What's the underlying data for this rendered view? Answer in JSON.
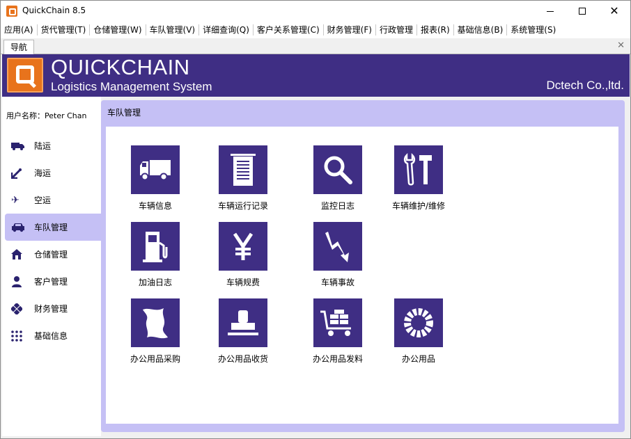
{
  "window": {
    "title": "QuickChain 8.5"
  },
  "menu": [
    "应用(A)",
    "货代管理(T)",
    "仓储管理(W)",
    "车队管理(V)",
    "详细查询(Q)",
    "客户关系管理(C)",
    "财务管理(F)",
    "行政管理",
    "报表(R)",
    "基础信息(B)",
    "系统管理(S)"
  ],
  "tabs": {
    "active": "导航"
  },
  "banner": {
    "brand": "QUICKCHAIN",
    "subtitle": "Logistics Management System",
    "company": "Dctech Co.,ltd."
  },
  "sidebar": {
    "user": "用户名称：Peter Chan",
    "items": [
      {
        "label": "陆运",
        "icon": "truck-icon"
      },
      {
        "label": "海运",
        "icon": "anchor-icon"
      },
      {
        "label": "空运",
        "icon": "airplane-icon"
      },
      {
        "label": "车队管理",
        "icon": "car-icon",
        "active": true
      },
      {
        "label": "仓储管理",
        "icon": "warehouse-icon"
      },
      {
        "label": "客户管理",
        "icon": "person-icon"
      },
      {
        "label": "财务管理",
        "icon": "diamond-icon"
      },
      {
        "label": "基础信息",
        "icon": "grid-dots-icon"
      }
    ]
  },
  "panel": {
    "title": "车队管理",
    "tiles": [
      {
        "label": "车辆信息",
        "icon": "truck-icon"
      },
      {
        "label": "车辆运行记录",
        "icon": "log-sheet-icon"
      },
      {
        "label": "监控日志",
        "icon": "magnifier-icon"
      },
      {
        "label": "车辆维护/维修",
        "icon": "tools-icon"
      },
      {
        "label": "加油日志",
        "icon": "fuel-pump-icon"
      },
      {
        "label": "车辆规费",
        "icon": "yen-icon"
      },
      {
        "label": "车辆事故",
        "icon": "lightning-icon"
      },
      {
        "label": "办公用品采购",
        "icon": "paper-icon"
      },
      {
        "label": "办公用品收货",
        "icon": "stamp-icon"
      },
      {
        "label": "办公用品发料",
        "icon": "cart-icon"
      },
      {
        "label": "办公用品",
        "icon": "gear-ring-icon"
      }
    ]
  },
  "colors": {
    "accent": "#3f2e84",
    "panel": "#c5c0f5",
    "logo": "#e8731c"
  }
}
